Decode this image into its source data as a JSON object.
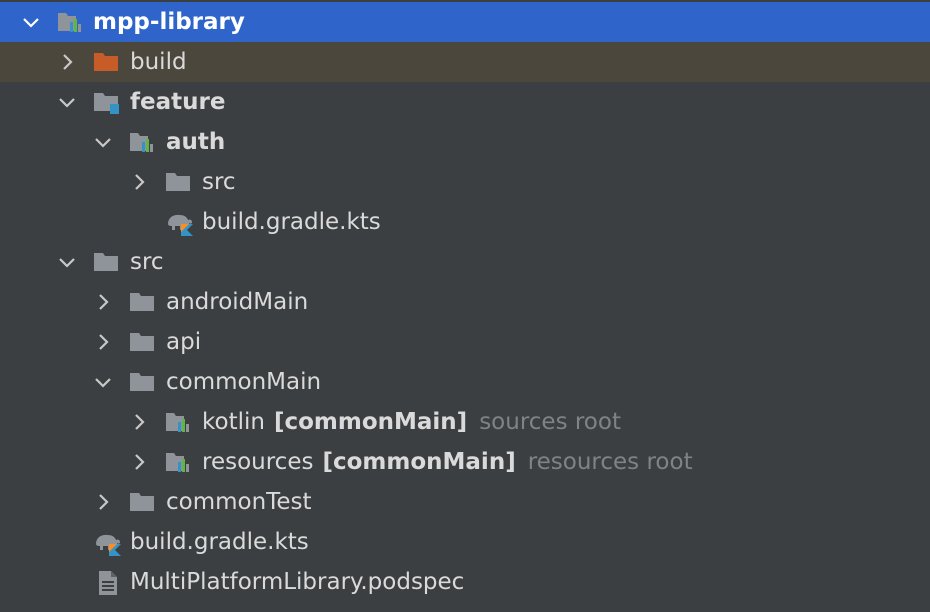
{
  "colors": {
    "background": "#3c3f41",
    "selected_row": "#2f65ca",
    "excluded_row": "#4b473d",
    "text": "#dadada",
    "hint_text": "#7f8386",
    "folder_gray": "#8e9499",
    "folder_orange": "#c75c29",
    "module_marker_blue": "#3592c4",
    "kotlin_orange": "#f98e28",
    "kotlin_blue": "#3592c4",
    "bars_green": "#62b543"
  },
  "tree": {
    "root": {
      "label": "mpp-library",
      "icon": "module-icon"
    },
    "build": {
      "label": "build",
      "icon": "excluded-folder-icon"
    },
    "feature": {
      "label": "feature",
      "icon": "module-group-icon"
    },
    "auth": {
      "label": "auth",
      "icon": "module-icon"
    },
    "auth_src": {
      "label": "src",
      "icon": "folder-icon"
    },
    "auth_gradle": {
      "label": "build.gradle.kts",
      "icon": "gradle-kotlin-file-icon"
    },
    "src": {
      "label": "src",
      "icon": "folder-icon"
    },
    "android_main": {
      "label": "androidMain",
      "icon": "folder-icon"
    },
    "api": {
      "label": "api",
      "icon": "folder-icon"
    },
    "common_main": {
      "label": "commonMain",
      "icon": "folder-icon"
    },
    "kotlin": {
      "label": "kotlin",
      "tag": "[commonMain]",
      "hint": "sources root",
      "icon": "source-root-icon"
    },
    "resources": {
      "label": "resources",
      "tag": "[commonMain]",
      "hint": "resources root",
      "icon": "resource-root-icon"
    },
    "common_test": {
      "label": "commonTest",
      "icon": "folder-icon"
    },
    "root_gradle": {
      "label": "build.gradle.kts",
      "icon": "gradle-kotlin-file-icon"
    },
    "podspec": {
      "label": "MultiPlatformLibrary.podspec",
      "icon": "text-file-icon"
    }
  }
}
